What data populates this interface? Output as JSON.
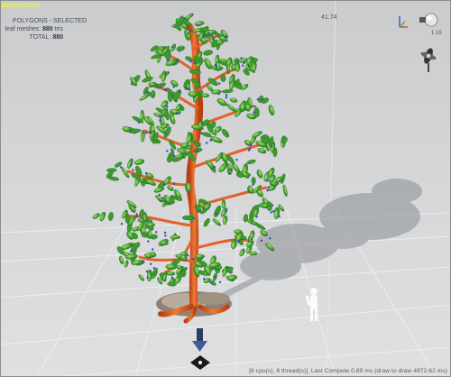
{
  "viewport": {
    "view_name": "perspective",
    "fps_readout": "41.74",
    "zoom_readout": "1.16"
  },
  "stats": {
    "title": "POLYGONS - SELECTED",
    "leaf_meshes_label": "leaf meshes:",
    "leaf_meshes_value": "880",
    "leaf_meshes_unit": "tris",
    "total_label": "TOTAL:",
    "total_value": "880"
  },
  "status_bar": {
    "text": "[6 cpu(s), 6 thread(s)], Last Compute 0.89 ms (draw to draw 4972.62 ms)"
  },
  "icons": {
    "axis_gizmo": "axis-gizmo-icon",
    "light": "light-bulb-icon",
    "wind": "wind-fan-icon",
    "move_arrow": "move-down-arrow-icon",
    "ground_pin": "ground-plane-pin-icon",
    "scale_figure": "human-scale-figure-icon"
  },
  "colors": {
    "background": "#d3d5d7",
    "view_label": "#ffff00",
    "trunk": "#d9551e",
    "leaf": "#3c9a2e",
    "leaf_highlight": "#8fd24a",
    "selection": "#3348c8"
  }
}
